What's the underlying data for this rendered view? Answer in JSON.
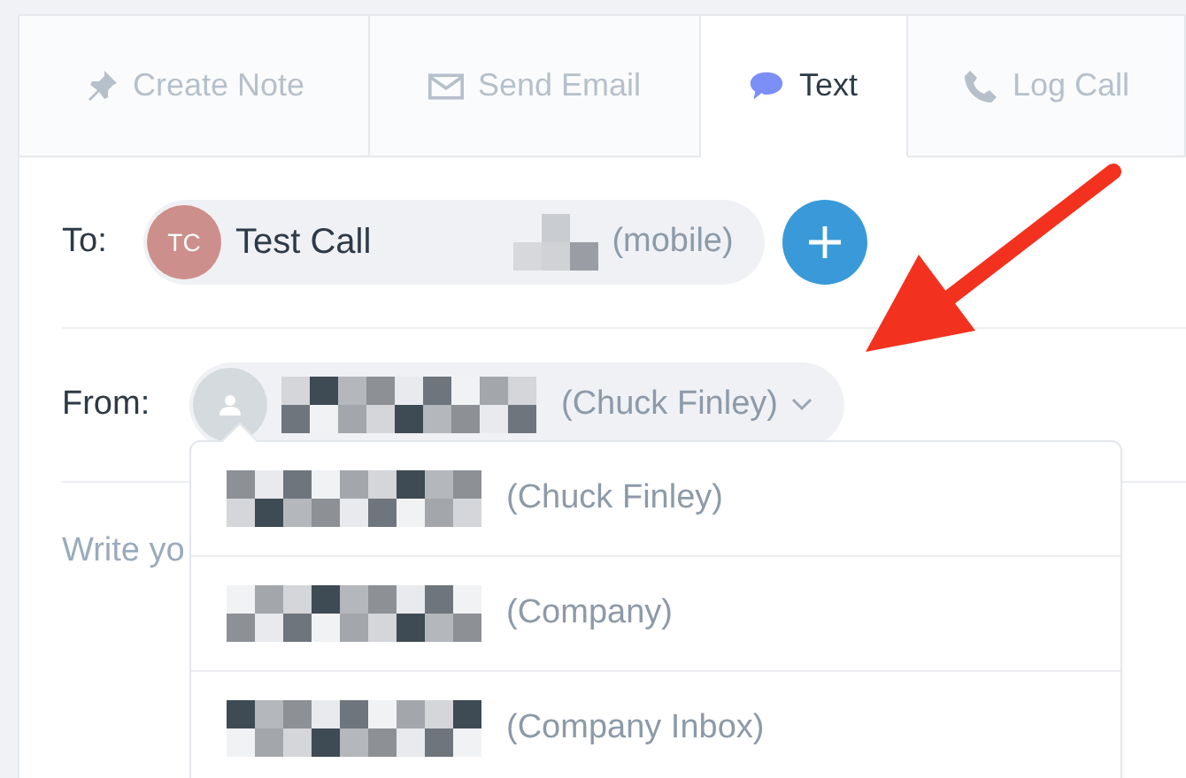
{
  "tabs": [
    {
      "label": "Create Note",
      "kind": "note",
      "selected": false
    },
    {
      "label": "Send Email",
      "kind": "email",
      "selected": false
    },
    {
      "label": "Text",
      "kind": "text",
      "selected": true
    },
    {
      "label": "Log Call",
      "kind": "call",
      "selected": false
    }
  ],
  "to": {
    "label": "To:",
    "initials": "TC",
    "name": "Test Call",
    "detail": "(mobile)"
  },
  "from": {
    "label": "From:",
    "detail": "(Chuck Finley)",
    "expanded": true
  },
  "message": {
    "placeholder": "Write yo"
  },
  "options": [
    {
      "detail": "(Chuck Finley)"
    },
    {
      "detail": "(Company)"
    },
    {
      "detail": "(Company Inbox)"
    }
  ]
}
